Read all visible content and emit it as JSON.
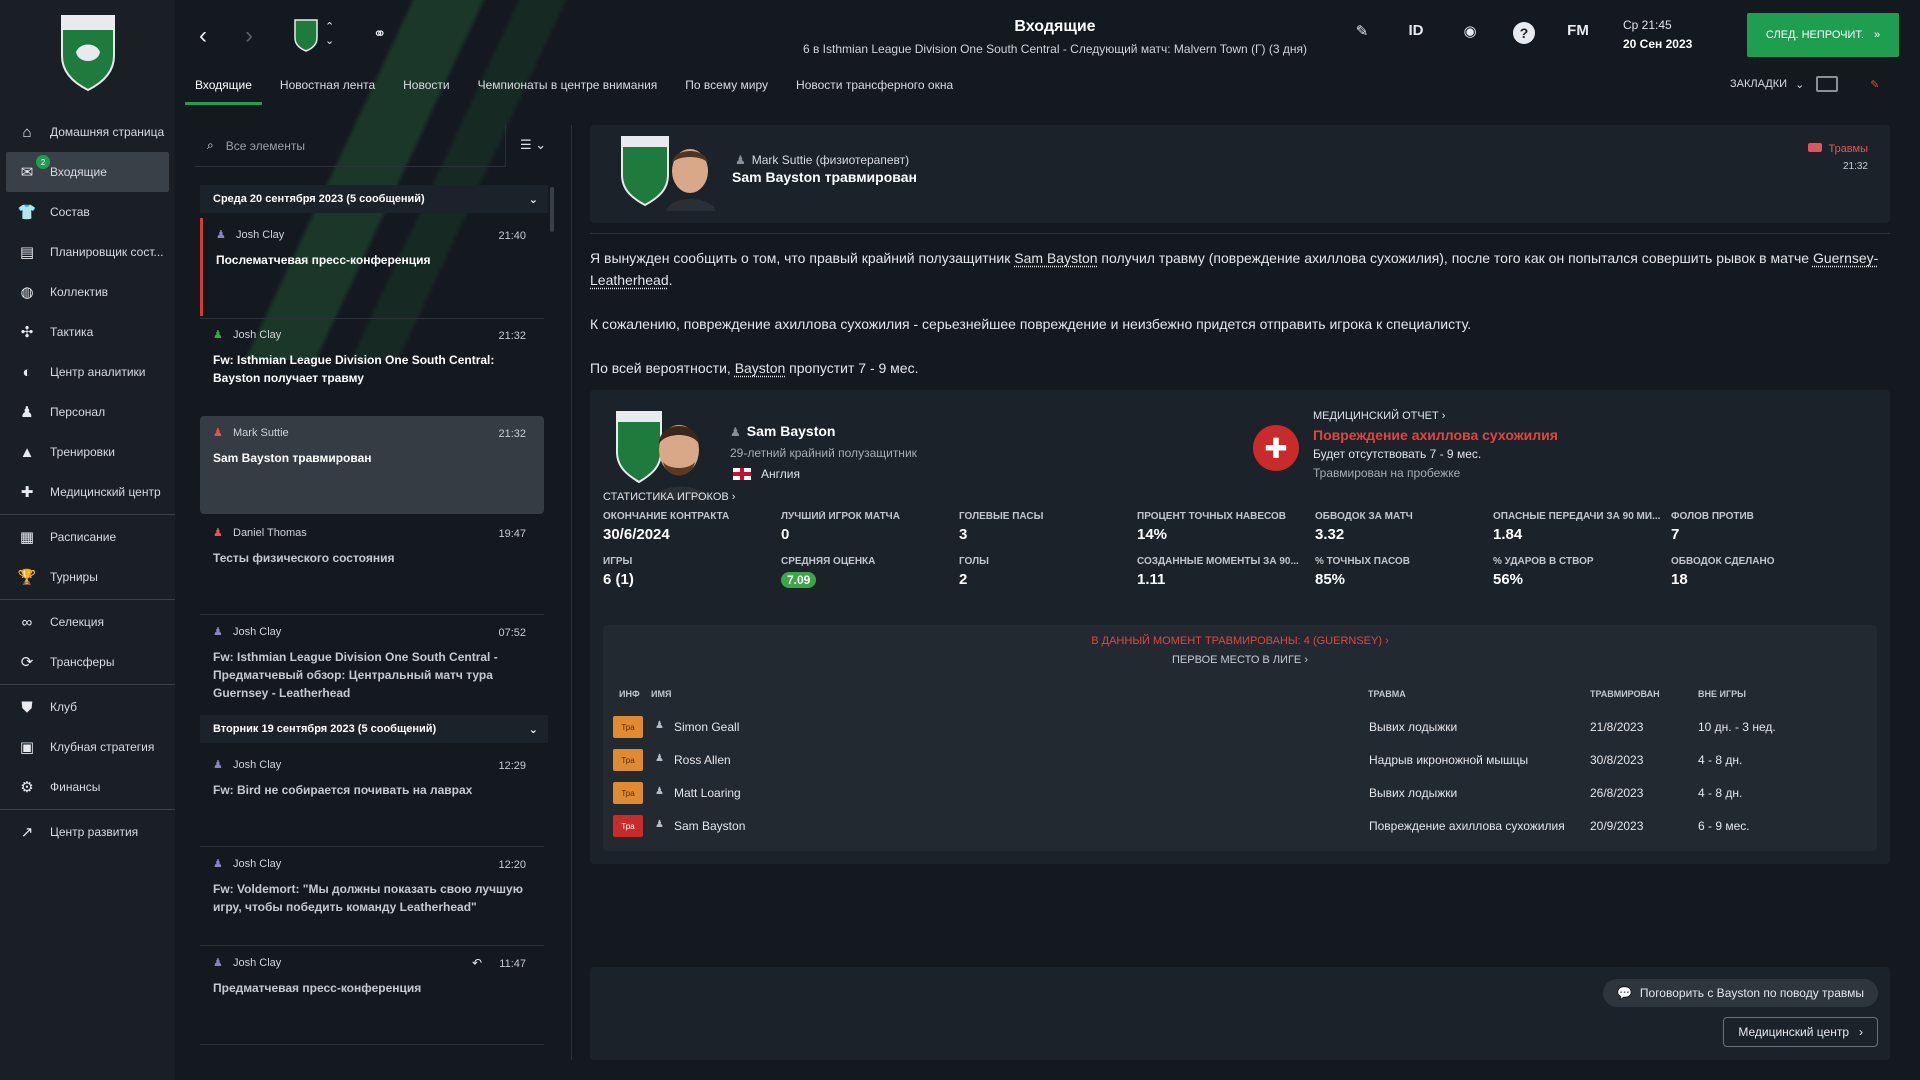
{
  "sidebar": {
    "items": [
      {
        "label": "Домашняя страница",
        "icon": "home-icon"
      },
      {
        "label": "Входящие",
        "icon": "inbox-icon",
        "badge": "2",
        "active": true
      },
      {
        "label": "Состав",
        "icon": "shirt-icon"
      },
      {
        "label": "Планировщик сост...",
        "icon": "planner-icon"
      },
      {
        "label": "Коллектив",
        "icon": "dynamics-icon"
      },
      {
        "label": "Тактика",
        "icon": "tactics-icon"
      },
      {
        "label": "Центр аналитики",
        "icon": "analytics-icon"
      },
      {
        "label": "Персонал",
        "icon": "staff-icon"
      },
      {
        "label": "Тренировки",
        "icon": "training-icon"
      },
      {
        "label": "Медицинский центр",
        "icon": "medical-icon"
      },
      {
        "label": "Расписание",
        "icon": "calendar-icon"
      },
      {
        "label": "Турниры",
        "icon": "trophy-icon"
      },
      {
        "label": "Селекция",
        "icon": "scouting-icon"
      },
      {
        "label": "Трансферы",
        "icon": "transfers-icon"
      },
      {
        "label": "Клуб",
        "icon": "club-icon"
      },
      {
        "label": "Клубная стратегия",
        "icon": "strategy-icon"
      },
      {
        "label": "Финансы",
        "icon": "finance-icon"
      },
      {
        "label": "Центр развития",
        "icon": "development-icon"
      }
    ]
  },
  "header": {
    "title": "Входящие",
    "subtitle": "6 в Isthmian League Division One South Central - Следующий матч: Malvern Town (Г) (3 дня)",
    "tabs": [
      "Входящие",
      "Новостная лента",
      "Новости",
      "Чемпионаты в центре внимания",
      "По всему миру",
      "Новости трансферного окна"
    ],
    "icons": [
      "pencil-icon",
      "ID",
      "globe-icon",
      "?",
      "FM"
    ],
    "day_time": "Ср 21:45",
    "date": "20 Сен 2023",
    "next_button": "СЛЕД. НЕПРОЧИТ.",
    "bookmarks": "ЗАКЛАДКИ"
  },
  "list": {
    "search_placeholder": "Все элементы",
    "groups": [
      {
        "title": "Среда 20 сентября 2023 (5 сообщений)"
      },
      {
        "title": "Вторник 19 сентября 2023 (5 сообщений)"
      }
    ],
    "messages": [
      {
        "from": "Josh Clay",
        "time": "21:40",
        "subject": "Послематчевая пресс-конференция"
      },
      {
        "from": "Josh Clay",
        "time": "21:32",
        "subject": "Fw: Isthmian League Division One South Central: Bayston получает травму"
      },
      {
        "from": "Mark Suttie",
        "time": "21:32",
        "subject": "Sam Bayston травмирован"
      },
      {
        "from": "Daniel Thomas",
        "time": "19:47",
        "subject": "Тесты физического состояния"
      },
      {
        "from": "Josh Clay",
        "time": "07:52",
        "subject": "Fw: Isthmian League Division One South Central - Предматчевый обзор: Центральный матч тура Guernsey - Leatherhead"
      },
      {
        "from": "Josh Clay",
        "time": "12:29",
        "subject": "Fw: Bird не собирается почивать на лаврах"
      },
      {
        "from": "Josh Clay",
        "time": "12:20",
        "subject": "Fw: Voldemort: \"Мы должны показать свою лучшую игру, чтобы победить команду Leatherhead\""
      },
      {
        "from": "Josh Clay",
        "time": "11:47",
        "subject": "Предматчевая пресс-конференция"
      }
    ]
  },
  "message": {
    "sender": "Mark Suttie (физиотерапевт)",
    "headline": "Sam Bayston травмирован",
    "category": "Травмы",
    "time": "21:32",
    "p1_a": "Я вынужден сообщить о том, что правый крайний полузащитник ",
    "p1_name": "Sam Bayston",
    "p1_b": " получил травму (повреждение ахиллова сухожилия), после того как он попытался совершить рывок в матче ",
    "p1_match": "Guernsey-Leatherhead",
    "p1_c": ".",
    "p2": "К сожалению, повреждение ахиллова сухожилия - серьезнейшее повреждение и неизбежно придется отправить игрока к специалисту.",
    "p3_a": "По всей вероятности, ",
    "p3_name": "Bayston",
    "p3_b": " пропустит 7 - 9 мес."
  },
  "player": {
    "name": "Sam Bayston",
    "desc": "29-летний крайний полузащитник",
    "nation": "Англия",
    "medical_label": "МЕДИЦИНСКИЙ ОТЧЕТ",
    "injury": "Повреждение ахиллова сухожилия",
    "out": "Будет отсутствовать 7 - 9 мес.",
    "where": "Травмирован на пробежке",
    "stats_title": "СТАТИСТИКА ИГРОКОВ",
    "stats": [
      {
        "label": "ОКОНЧАНИЕ КОНТРАКТА",
        "value": "30/6/2024"
      },
      {
        "label": "ЛУЧШИЙ ИГРОК МАТЧА",
        "value": "0"
      },
      {
        "label": "ГОЛЕВЫЕ ПАСЫ",
        "value": "3"
      },
      {
        "label": "ПРОЦЕНТ ТОЧНЫХ НАВЕСОВ",
        "value": "14%"
      },
      {
        "label": "ОБВОДОК ЗА МАТЧ",
        "value": "3.32"
      },
      {
        "label": "ОПАСНЫЕ ПЕРЕДАЧИ ЗА 90 МИ...",
        "value": "1.84"
      },
      {
        "label": "ФОЛОВ ПРОТИВ",
        "value": "7"
      },
      {
        "label": "ИГРЫ",
        "value": "6 (1)"
      },
      {
        "label": "СРЕДНЯЯ ОЦЕНКА",
        "value": "7.09"
      },
      {
        "label": "ГОЛЫ",
        "value": "2"
      },
      {
        "label": "СОЗДАННЫЕ МОМЕНТЫ ЗА 90...",
        "value": "1.11"
      },
      {
        "label": "% ТОЧНЫХ ПАСОВ",
        "value": "85%"
      },
      {
        "label": "% УДАРОВ В СТВОР",
        "value": "56%"
      },
      {
        "label": "ОБВОДОК СДЕЛАНО",
        "value": "18"
      }
    ]
  },
  "injuries": {
    "now": "В ДАННЫЙ МОМЕНТ ТРАВМИРОВАНЫ: 4 (GUERNSEY)",
    "league": "ПЕРВОЕ МЕСТО В ЛИГЕ",
    "headers": {
      "inf": "ИНФ",
      "name": "ИМЯ",
      "injury": "ТРАВМА",
      "date": "ТРАВМИРОВАН",
      "out": "ВНЕ ИГРЫ"
    },
    "rows": [
      {
        "tag": "Тра",
        "name": "Simon Geall",
        "injury": "Вывих лодыжки",
        "date": "21/8/2023",
        "out": "10 дн. - 3 нед.",
        "severity": "orange"
      },
      {
        "tag": "Тра",
        "name": "Ross Allen",
        "injury": "Надрыв икроножной мышцы",
        "date": "30/8/2023",
        "out": "4 - 8 дн.",
        "severity": "orange"
      },
      {
        "tag": "Тра",
        "name": "Matt Loaring",
        "injury": "Вывих лодыжки",
        "date": "26/8/2023",
        "out": "4 - 8 дн.",
        "severity": "orange"
      },
      {
        "tag": "Тра",
        "name": "Sam Bayston",
        "injury": "Повреждение ахиллова сухожилия",
        "date": "20/9/2023",
        "out": "6 - 9 мес.",
        "severity": "red"
      }
    ]
  },
  "actions": {
    "talk": "Поговорить с Bayston по поводу травмы",
    "medical": "Медицинский центр"
  },
  "colors": {
    "accent": "#1f9e52",
    "injury_red": "#e2453f",
    "tag_orange": "#e08a33"
  }
}
